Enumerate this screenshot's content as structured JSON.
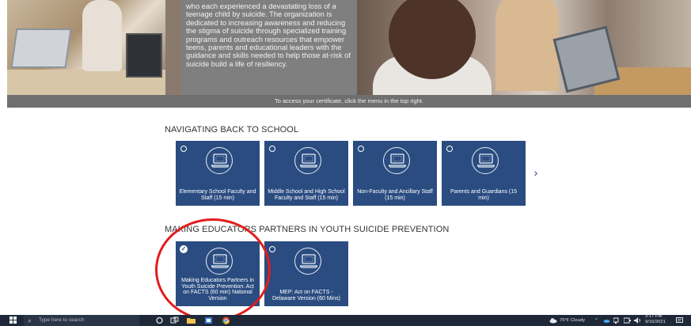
{
  "hero": {
    "text": "who each experienced a devastating loss of a teenage child by suicide. The organization is dedicated to increasing awareness and reducing the stigma of suicide through specialized training programs and outreach resources that empower teens, parents and educational leaders with the guidance and skills needed to help those at-risk of suicide build a life of resiliency."
  },
  "certificate_bar": "To access your certificate, click the menu in the top right.",
  "sections": [
    {
      "title": "NAVIGATING BACK TO SCHOOL",
      "courses": [
        {
          "label": "Elementary School Faculty and Staff (15 min)",
          "completed": false
        },
        {
          "label": "Middle School and High School Faculty and Staff (15 min)",
          "completed": false
        },
        {
          "label": "Non-Faculty and Ancillary Staff (15 min)",
          "completed": false
        },
        {
          "label": "Parents and Guardians (15 min)",
          "completed": false
        }
      ],
      "next_arrow": "›"
    },
    {
      "title": "MAKING EDUCATORS PARTNERS IN YOUTH SUICIDE PREVENTION",
      "courses": [
        {
          "label": "Making Educators Partners in Youth Suicide Prevention: Act on FACTS (60 min) National Version",
          "completed": true
        },
        {
          "label": "MEP: Act on FACTS - Delaware Version (60 Mins)",
          "completed": false
        }
      ]
    }
  ],
  "taskbar": {
    "search_placeholder": "Type here to search",
    "weather": "75°F Cloudy",
    "time": "3:17 PM",
    "date": "9/16/2021"
  },
  "colors": {
    "card_blue": "#2a4c80",
    "annotation_red": "#e21d1d",
    "taskbar": "#1e2838"
  }
}
